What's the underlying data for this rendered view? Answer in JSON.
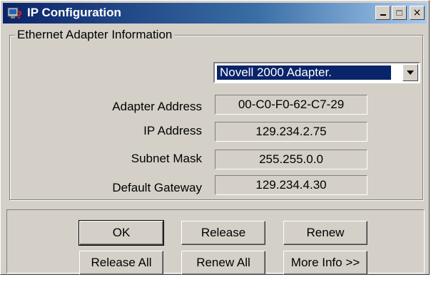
{
  "window": {
    "title": "IP Configuration",
    "icon": "ip-config-app-icon",
    "controls": {
      "minimize": "_",
      "maximize": "□",
      "close": "×"
    }
  },
  "group": {
    "label": "Ethernet Adapter Information",
    "adapter_select": {
      "selected": "Novell 2000 Adapter."
    },
    "fields": [
      {
        "label": "Adapter Address",
        "value": "00-C0-F0-62-C7-29"
      },
      {
        "label": "IP Address",
        "value": "129.234.2.75"
      },
      {
        "label": "Subnet Mask",
        "value": "255.255.0.0"
      },
      {
        "label": "Default Gateway",
        "value": "129.234.4.30"
      }
    ]
  },
  "buttons": {
    "ok": "OK",
    "release": "Release",
    "renew": "Renew",
    "release_all": "Release All",
    "renew_all": "Renew All",
    "more_info": "More Info >>"
  },
  "colors": {
    "titlebar_start": "#0a246a",
    "titlebar_end": "#a6caf0",
    "dialog_face": "#d4d0c8",
    "selection": "#0a246a"
  }
}
